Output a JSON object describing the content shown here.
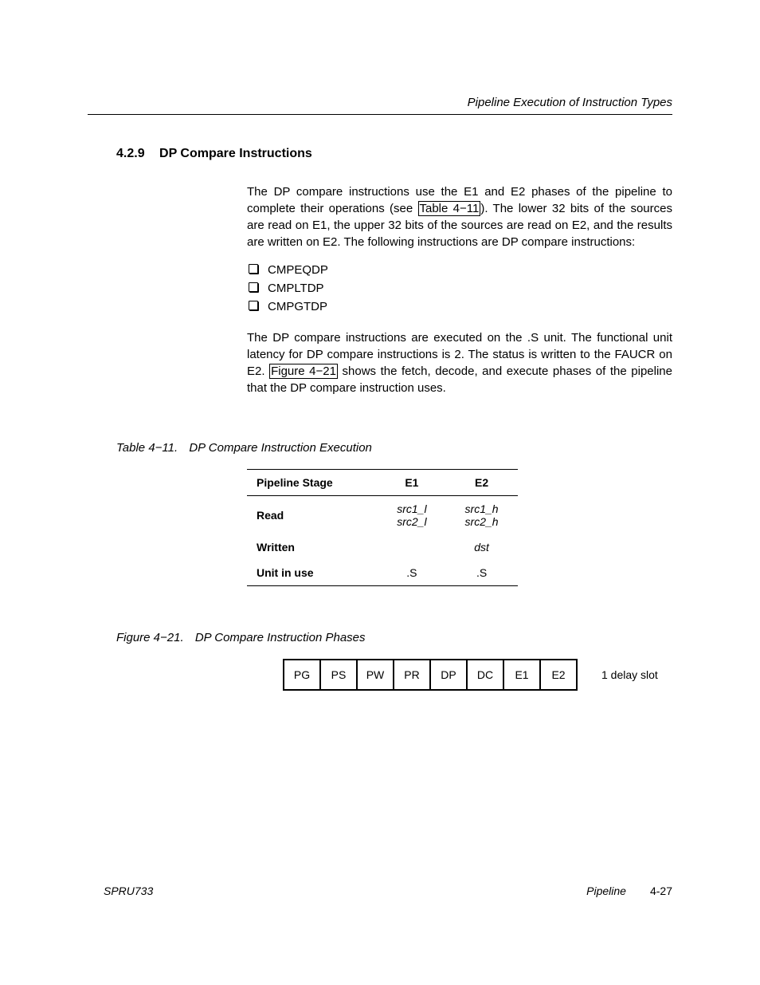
{
  "runningHead": "Pipeline Execution of Instruction Types",
  "section": {
    "number": "4.2.9",
    "title": "DP Compare Instructions"
  },
  "para1_a": "The DP compare instructions use the E1 and E2 phases of the pipeline to complete their operations (see ",
  "tableRef": "Table 4−11",
  "para1_b": "). The lower 32 bits of the sources are read on E1, the upper 32 bits of the sources are read on E2, and the results are written on E2. The following instructions are DP compare instructions:",
  "bullets": [
    "CMPEQDP",
    "CMPLTDP",
    "CMPGTDP"
  ],
  "para2_a": "The DP compare instructions are executed on the .S unit. The functional unit latency for DP compare instructions is 2. The status is written to the FAUCR on E2. ",
  "figRef": "Figure 4−21",
  "para2_b": " shows the fetch, decode, and execute phases of the pipeline that the DP compare instruction uses.",
  "tableCaption": {
    "label": "Table 4−11.",
    "title": "DP Compare Instruction Execution"
  },
  "table": {
    "headers": [
      "Pipeline Stage",
      "E1",
      "E2"
    ],
    "rows": [
      {
        "label": "Read",
        "e1a": "src1_l",
        "e1b": "src2_l",
        "e2a": "src1_h",
        "e2b": "src2_h"
      },
      {
        "label": "Written",
        "e1": "",
        "e2": "dst"
      },
      {
        "label": "Unit in use",
        "e1": ".S",
        "e2": ".S"
      }
    ]
  },
  "figCaption": {
    "label": "Figure 4−21.",
    "title": "DP Compare Instruction Phases"
  },
  "phases": [
    "PG",
    "PS",
    "PW",
    "PR",
    "DP",
    "DC",
    "E1",
    "E2"
  ],
  "phaseNote": "1 delay slot",
  "footer": {
    "left": "SPRU733",
    "chapter": "Pipeline",
    "page": "4-27"
  }
}
